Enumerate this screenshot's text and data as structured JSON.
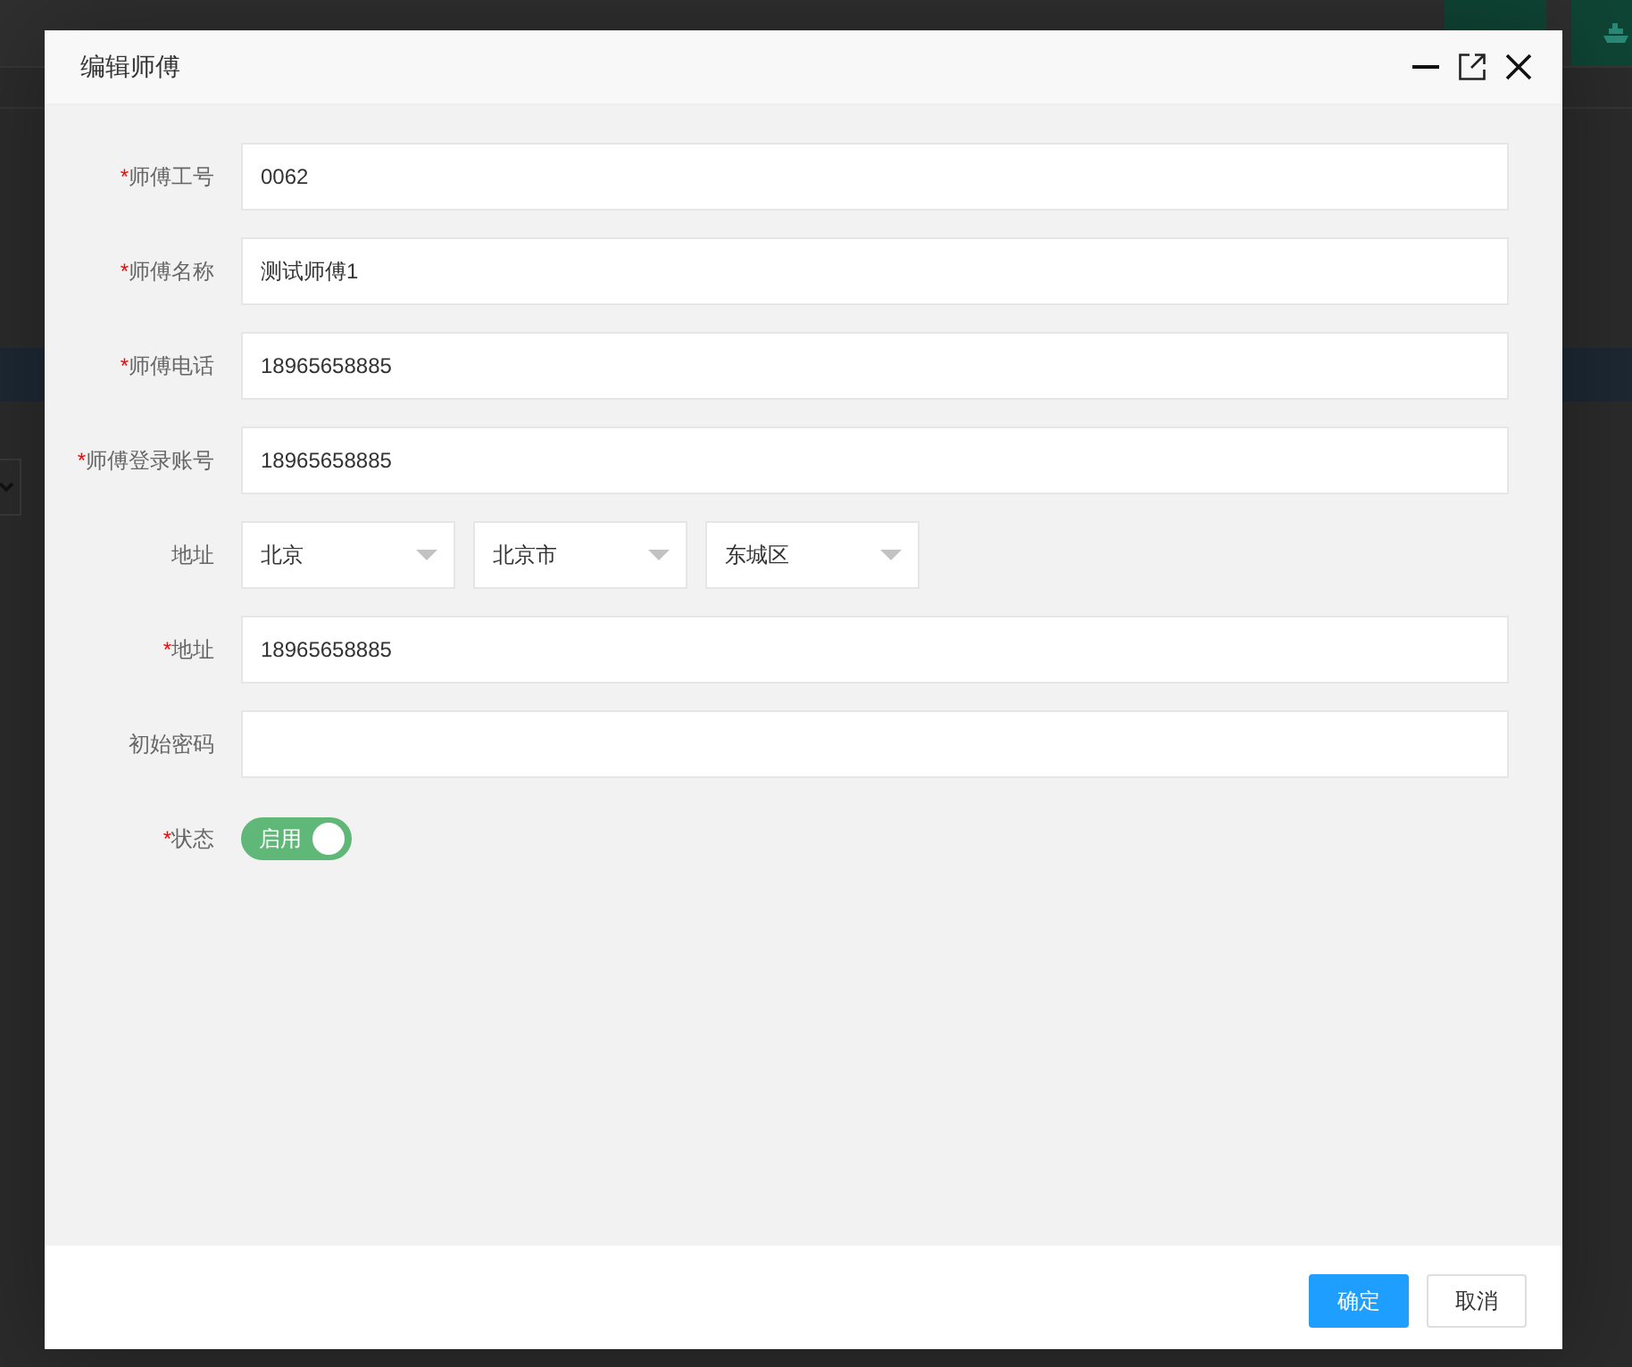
{
  "dialog": {
    "title": "编辑师傅"
  },
  "form": {
    "fields": [
      {
        "kind": "text",
        "mark": "*",
        "label": "师傅工号",
        "value": "0062"
      },
      {
        "kind": "text",
        "mark": "*",
        "label": "师傅名称",
        "value": "测试师傅1"
      },
      {
        "kind": "text",
        "mark": "*",
        "label": "师傅电话",
        "value": "18965658885"
      },
      {
        "kind": "text",
        "mark": "*",
        "label": "师傅登录账号",
        "value": "18965658885"
      },
      {
        "kind": "selects",
        "label": "地址",
        "values": [
          "北京",
          "北京市",
          "东城区"
        ]
      },
      {
        "kind": "text",
        "mark": "*",
        "label": "地址",
        "value": "18965658885"
      },
      {
        "kind": "text",
        "label": "初始密码"
      },
      {
        "kind": "switch",
        "mark": "*",
        "label": "状态",
        "on": true,
        "text": "启用"
      }
    ]
  },
  "buttons": [
    {
      "kind": "primary",
      "label": "确定"
    },
    {
      "kind": "default",
      "label": "取消"
    }
  ]
}
